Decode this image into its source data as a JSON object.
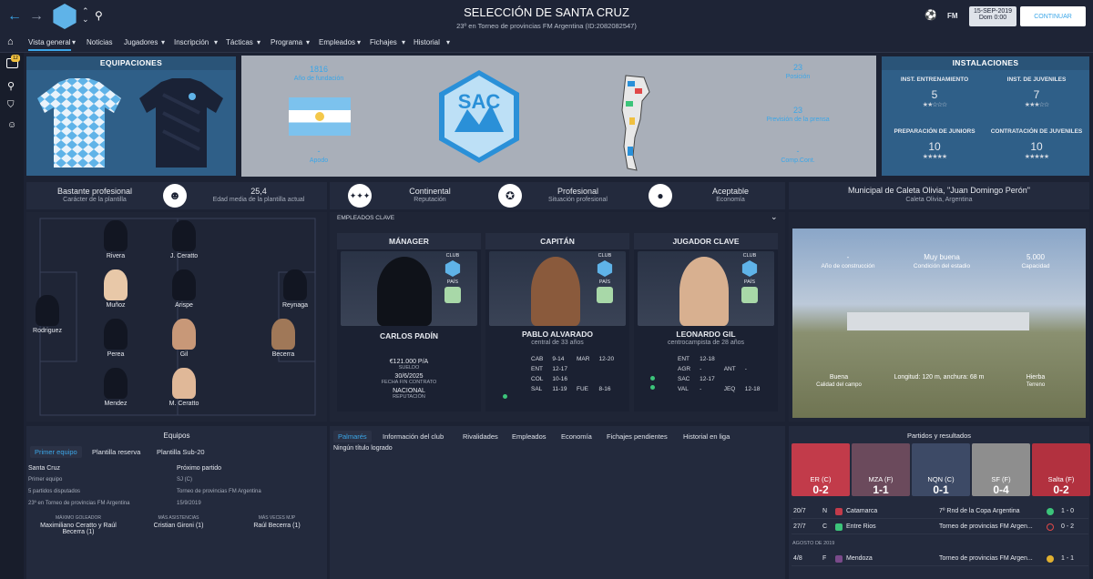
{
  "top": {
    "title": "SELECCIÓN DE SANTA CRUZ",
    "subtitle": "23º en Torneo de provincias FM Argentina (ID:2082082547)",
    "date": "15-SEP-2019",
    "day": "Dom 0:00",
    "continue": "CONTINUAR",
    "fm": "FM",
    "badge_count": "12"
  },
  "nav": [
    "Vista general",
    "Noticias",
    "Jugadores",
    "Inscripción",
    "Tácticas",
    "Programa",
    "Empleados",
    "Fichajes",
    "Historial"
  ],
  "kits": {
    "title": "EQUIPACIONES"
  },
  "club": {
    "founded": "1816",
    "founded_label": "Año de fundación",
    "nickname": "-",
    "nickname_label": "Apodo",
    "position": "23",
    "position_label": "Posición",
    "prediction": "23",
    "prediction_label": "Previsión de la prensa",
    "comp": "-",
    "comp_label": "Comp.Cont."
  },
  "facilities": {
    "title": "INSTALACIONES",
    "items": [
      {
        "label": "INST. ENTRENAMIENTO",
        "value": "5",
        "stars": "★★☆☆☆"
      },
      {
        "label": "INST. DE JUVENILES",
        "value": "7",
        "stars": "★★★☆☆"
      },
      {
        "label": "PREPARACIÓN DE JUNIORS",
        "value": "10",
        "stars": "★★★★★"
      },
      {
        "label": "CONTRATACIÓN DE JUVENILES",
        "value": "10",
        "stars": "★★★★★"
      }
    ]
  },
  "info": {
    "character": "Bastante profesional",
    "character_label": "Carácter de la plantilla",
    "age": "25,4",
    "age_label": "Edad media de la plantilla actual",
    "reputation": "Continental",
    "reputation_label": "Reputación",
    "status": "Profesional",
    "status_label": "Situación profesional",
    "economy": "Aceptable",
    "economy_label": "Economía"
  },
  "stadium": {
    "name": "Municipal de Caleta Olivia, \"Juan Domingo Perón\"",
    "location": "Caleta Olivia, Argentina",
    "built": "-",
    "built_label": "Año de construcción",
    "condition": "Muy buena",
    "condition_label": "Condición del estadio",
    "capacity": "5.000",
    "capacity_label": "Capacidad",
    "pitch": "Buena",
    "pitch_label": "Calidad del campo",
    "size": "Longitud: 120 m, anchura: 68 m",
    "size_label": "Dimensiones",
    "surface": "Hierba",
    "surface_label": "Terreno"
  },
  "formation": {
    "players": [
      "Rivera",
      "J. Ceratto",
      "Muñoz",
      "Arispe",
      "Reynaga",
      "Rodriguez",
      "Perea",
      "Gil",
      "Becerra",
      "Mendez",
      "M. Ceratto"
    ]
  },
  "staff": {
    "section_label": "EMPLEADOS CLAVE",
    "club_label": "CLUB",
    "country_label": "PAÍS",
    "manager": {
      "title": "MÁNAGER",
      "name": "CARLOS PADÍN",
      "wage": "€121.000 P/A",
      "wage_label": "SUELDO",
      "contract": "30/6/2025",
      "contract_label": "FECHA FIN CONTRATO",
      "rep": "NACIONAL",
      "rep_label": "REPUTACIÓN"
    },
    "captain": {
      "title": "CAPITÁN",
      "name": "PABLO ALVARADO",
      "desc": "central de 33 años",
      "stats": [
        [
          "CAB",
          "9-14",
          "MAR",
          "12-20"
        ],
        [
          "ENT",
          "12-17",
          "",
          ""
        ],
        [
          "COL",
          "10-16",
          "",
          ""
        ],
        [
          "SAL",
          "11-19",
          "FUE",
          "8-16"
        ]
      ]
    },
    "key": {
      "title": "JUGADOR CLAVE",
      "name": "LEONARDO GIL",
      "desc": "centrocampista de 28 años",
      "stats": [
        [
          "ENT",
          "12-18",
          "",
          ""
        ],
        [
          "AGR",
          "-",
          "ANT",
          "-"
        ],
        [
          "SAC",
          "12-17",
          "",
          ""
        ],
        [
          "VAL",
          "-",
          "JEQ",
          "12-18"
        ]
      ]
    }
  },
  "teams": {
    "title": "Equipos",
    "tabs": [
      "Primer equipo",
      "Plantilla reserva",
      "Plantilla Sub-20"
    ],
    "left": [
      "Santa Cruz",
      "Primer equipo",
      "5 partidos disputados",
      "23º en Torneo de provincias FM Argentina"
    ],
    "next_label": "Próximo partido",
    "right": [
      "SJ (C)",
      "Torneo de provincias FM Argentina",
      "15/9/2019"
    ],
    "scorer_label": "MÁXIMO GOLEADOR",
    "scorer": "Maximiliano Ceratto y Raúl Becerra (1)",
    "assists_label": "MÁS ASISTENCIAS",
    "assists": "Cristian Gironi (1)",
    "mvp_label": "MÁS VECES MJP",
    "mvp": "Raúl Becerra (1)"
  },
  "history": {
    "tabs": [
      "Palmarés",
      "Información del club",
      "Rivalidades",
      "Empleados",
      "Economía",
      "Fichajes pendientes",
      "Historial en liga"
    ],
    "text": "Ningún título logrado"
  },
  "matches": {
    "title": "Partidos y resultados",
    "recent": [
      {
        "team": "ER (C)",
        "score": "0-2",
        "color": "#c23b4a"
      },
      {
        "team": "MZA (F)",
        "score": "1-1",
        "color": "#6b4a5c"
      },
      {
        "team": "NQN (C)",
        "score": "0-1",
        "color": "#3d4a66"
      },
      {
        "team": "SF (F)",
        "score": "0-4",
        "color": "#d7d7d7"
      },
      {
        "team": "Salta (F)",
        "score": "0-2",
        "color": "#b2313f"
      }
    ],
    "rows": [
      {
        "date": "20/7",
        "venue": "N",
        "team": "Catamarca",
        "comp": "7º Rnd de la Copa Argentina",
        "result": "1 - 0",
        "dot": "#3cc47a"
      },
      {
        "date": "27/7",
        "venue": "C",
        "team": "Entre Rios",
        "comp": "Torneo de provincias FM Argen...",
        "result": "0 - 2",
        "dot": "#e04848"
      },
      {
        "date": "4/8",
        "venue": "F",
        "team": "Mendoza",
        "comp": "Torneo de provincias FM Argen...",
        "result": "1 - 1",
        "dot": "#e0b030"
      }
    ],
    "month": "AGOSTO DE 2019"
  }
}
